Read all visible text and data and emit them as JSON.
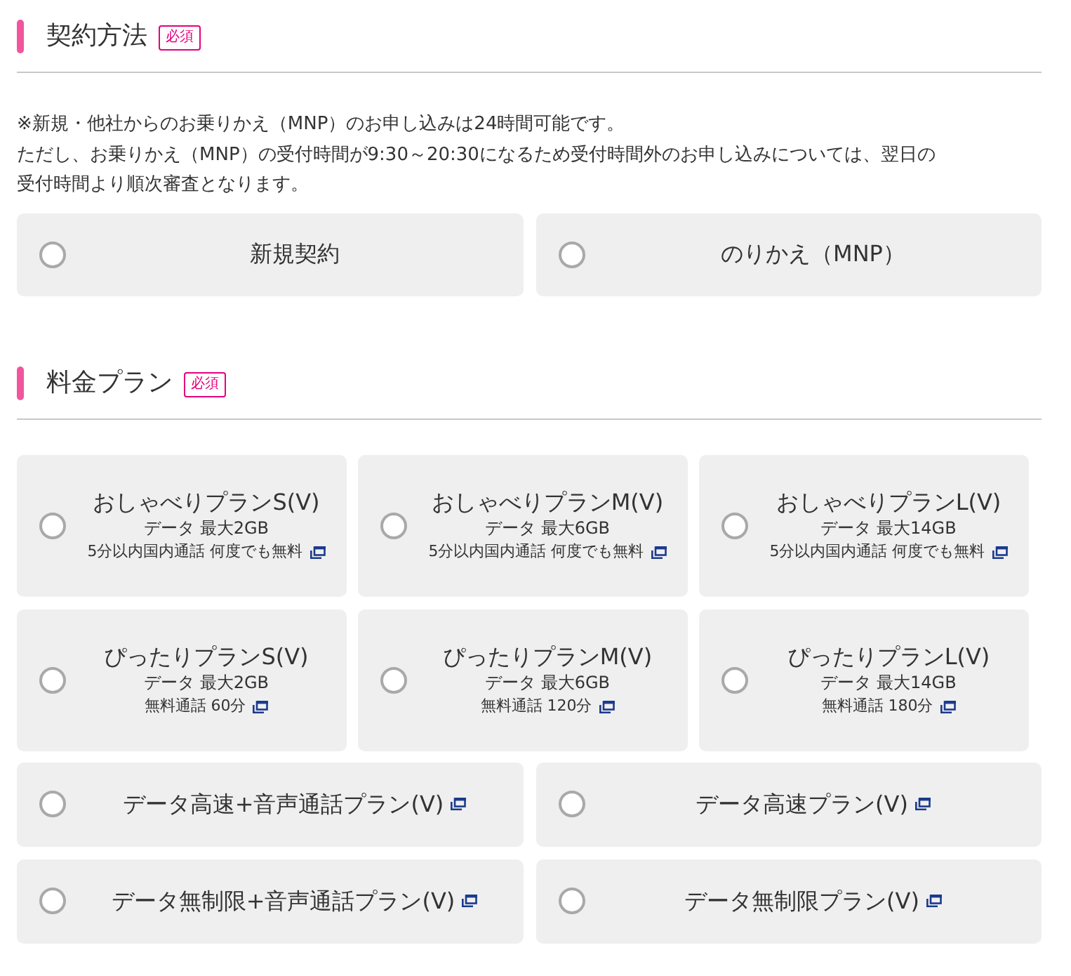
{
  "sections": [
    {
      "title": "契約方法",
      "badge": "必須",
      "note": [
        "※新規・他社からのお乗りかえ（MNP）のお申し込みは24時間可能です。",
        "ただし、お乗りかえ（MNP）の受付時間が9:30～20:30になるため受付時間外のお申し込みについては、翌日の",
        "受付時間より順次審査となります。"
      ],
      "options": [
        {
          "label": "新規契約",
          "selected": false
        },
        {
          "label": "のりかえ（MNP）",
          "selected": false
        }
      ]
    },
    {
      "title": "料金プラン",
      "badge": "必須",
      "plans": [
        {
          "kind": "detailed",
          "name": "おしゃべりプランS(V)",
          "data": "データ 最大2GB",
          "calls": "5分以内国内通話 何度でも無料",
          "selected": false
        },
        {
          "kind": "detailed",
          "name": "おしゃべりプランM(V)",
          "data": "データ 最大6GB",
          "calls": "5分以内国内通話 何度でも無料",
          "selected": false
        },
        {
          "kind": "detailed",
          "name": "おしゃべりプランL(V)",
          "data": "データ 最大14GB",
          "calls": "5分以内国内通話 何度でも無料",
          "selected": false
        },
        {
          "kind": "detailed",
          "name": "ぴったりプランS(V)",
          "data": "データ 最大2GB",
          "calls": "無料通話 60分",
          "selected": false
        },
        {
          "kind": "detailed",
          "name": "ぴったりプランM(V)",
          "data": "データ 最大6GB",
          "calls": "無料通話 120分",
          "selected": false
        },
        {
          "kind": "detailed",
          "name": "ぴったりプランL(V)",
          "data": "データ 最大14GB",
          "calls": "無料通話 180分",
          "selected": false
        },
        {
          "kind": "simple",
          "name": "データ高速+音声通話プラン(V)",
          "selected": false
        },
        {
          "kind": "simple",
          "name": "データ高速プラン(V)",
          "selected": false
        },
        {
          "kind": "simple",
          "name": "データ無制限+音声通話プラン(V)",
          "selected": false
        },
        {
          "kind": "simple",
          "name": "データ無制限プラン(V)",
          "selected": false
        }
      ]
    }
  ]
}
